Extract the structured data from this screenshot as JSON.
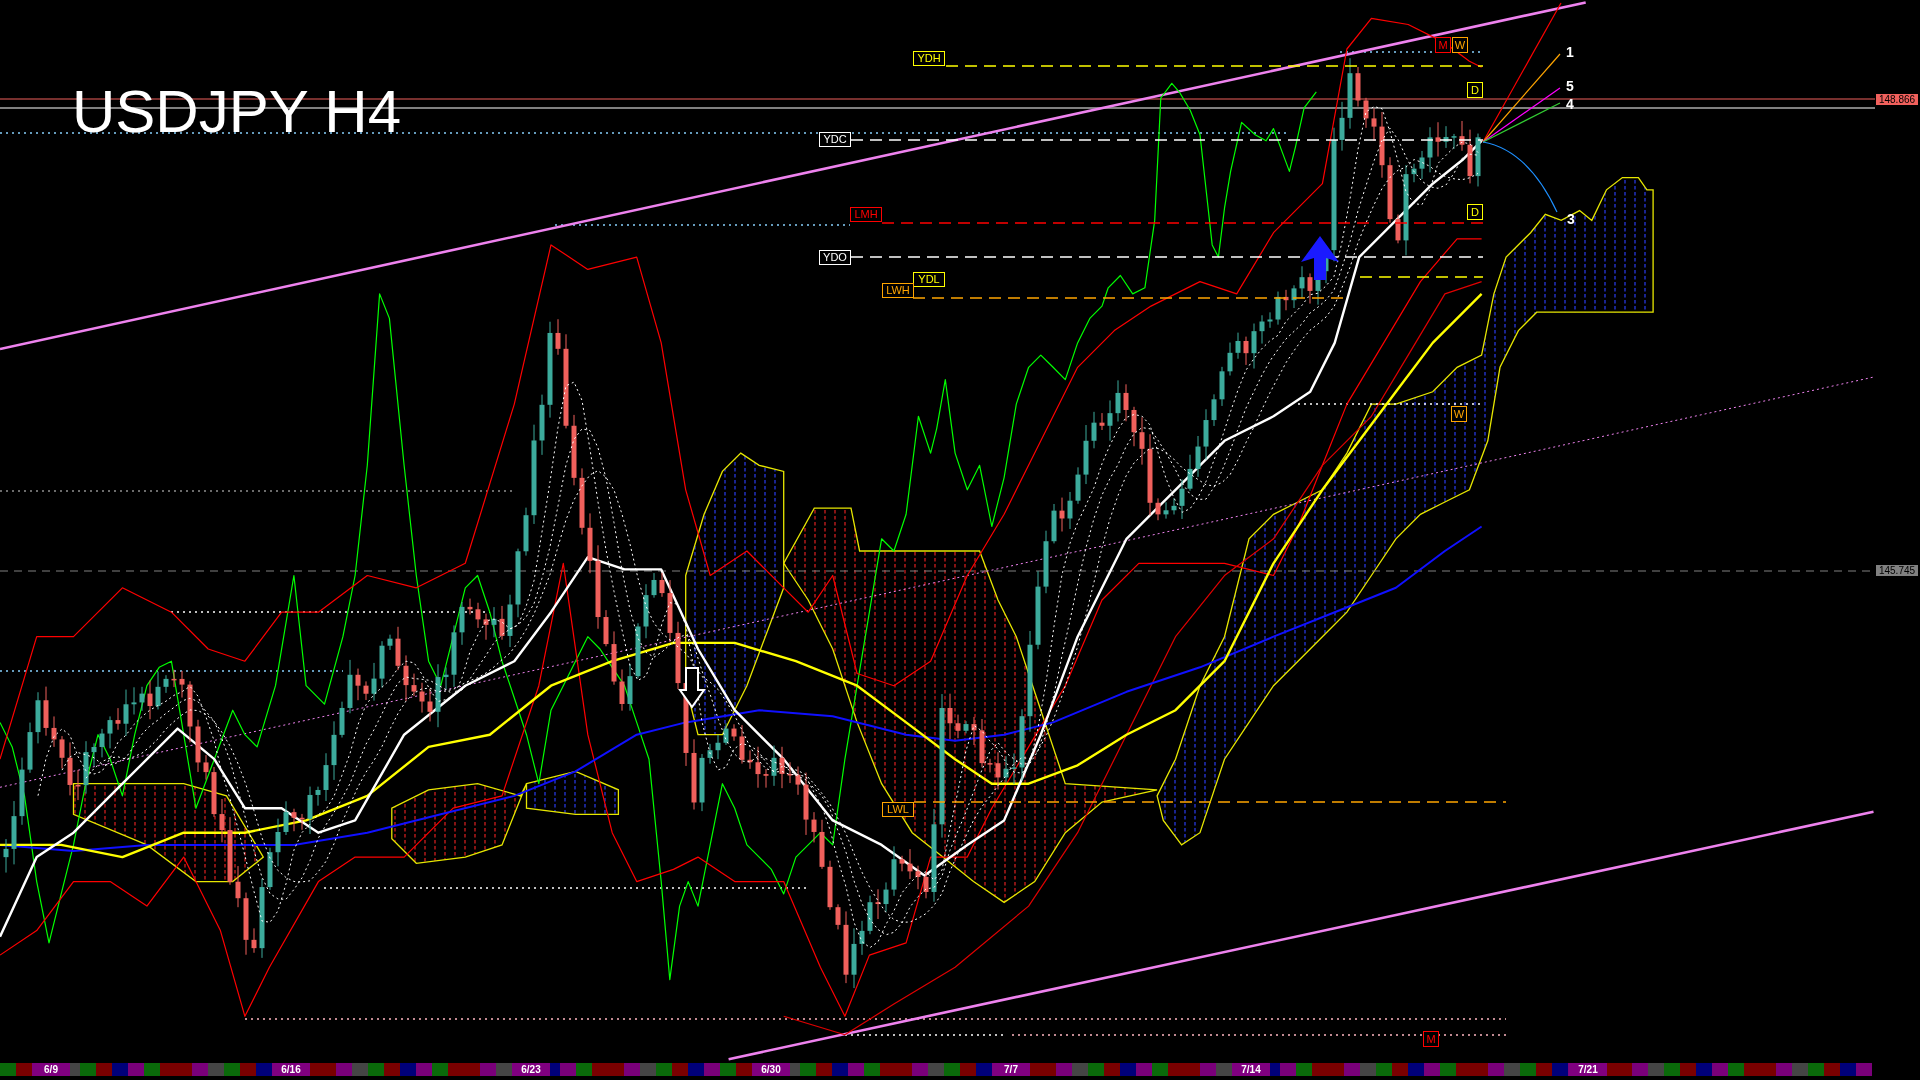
{
  "chart": {
    "title": "USDJPY H4",
    "level_tags": [
      {
        "text": "YDH",
        "color": "#ffff00"
      },
      {
        "text": "YDC",
        "color": "#ffffff"
      },
      {
        "text": "LMH",
        "color": "#ff0000"
      },
      {
        "text": "YDO",
        "color": "#ffffff"
      },
      {
        "text": "YDL",
        "color": "#ffff00"
      },
      {
        "text": "LWH",
        "color": "#ffa500"
      },
      {
        "text": "LWL",
        "color": "#ffa500"
      }
    ],
    "period_tags": [
      {
        "text": "M",
        "color": "#ff0000"
      },
      {
        "text": "W",
        "color": "#ffa500"
      },
      {
        "text": "D",
        "color": "#ffff00"
      },
      {
        "text": "D",
        "color": "#ffff00"
      },
      {
        "text": "W",
        "color": "#ffa500"
      },
      {
        "text": "M",
        "color": "#ff0000"
      }
    ],
    "fan_lines": [
      {
        "label": "1",
        "color": "#ffa500"
      },
      {
        "label": "5",
        "color": "#ff00ff"
      },
      {
        "label": "4",
        "color": "#32cd32"
      },
      {
        "label": "3",
        "color": "#1e90ff"
      }
    ],
    "price_tags": [
      {
        "text": "148.866",
        "color": "#f0605c"
      },
      {
        "text": "145.745",
        "color": "#808080"
      }
    ],
    "time_axis": {
      "labels": [
        "6/9",
        "6/16",
        "6/23",
        "6/30",
        "7/7",
        "7/14",
        "7/21"
      ]
    }
  }
}
